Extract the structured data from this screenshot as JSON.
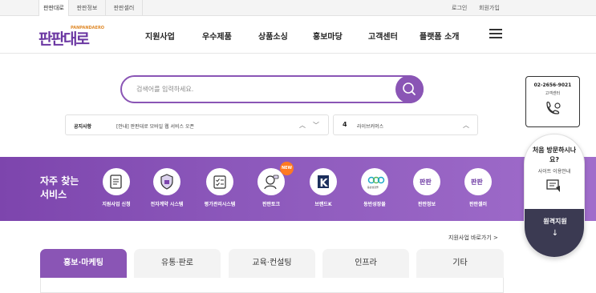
{
  "topbar": {
    "tabs": [
      "판판대로",
      "판판정보",
      "판판셀러"
    ],
    "login": "로그인",
    "signup": "회원가입"
  },
  "header": {
    "logo_text": "판판대로",
    "logo_sub": "PANPANDAERO",
    "nav": [
      "지원사업",
      "우수제품",
      "상품소싱",
      "홍보마당",
      "고객센터",
      "플랫폼 소개"
    ]
  },
  "search": {
    "placeholder": "검색어를 입력하세요."
  },
  "notice": {
    "label": "공지사항",
    "text": "[안내] 판판대로 모바일 웹 서비스 오픈"
  },
  "live": {
    "rank": "4",
    "text": "라이브커머스"
  },
  "services": {
    "title": "자주 찾는 서비스",
    "items": [
      {
        "label": "지원사업 신청",
        "icon": "application-icon"
      },
      {
        "label": "전자계약 시스템",
        "icon": "contract-shield-icon"
      },
      {
        "label": "평가관리시스템",
        "icon": "evaluation-icon"
      },
      {
        "label": "판판토크",
        "icon": "talk-icon",
        "badge": "NEW"
      },
      {
        "label": "브랜드K",
        "icon": "brandk-icon",
        "glyph": "K"
      },
      {
        "label": "동반성장몰",
        "icon": "mall-icon",
        "glyph": "동반성장몰"
      },
      {
        "label": "판판정보",
        "icon": "panpan-info-icon",
        "glyph": "판판"
      },
      {
        "label": "판판셀러",
        "icon": "panpan-seller-icon",
        "glyph": "판판"
      }
    ]
  },
  "shortcut": "지원사업 바로가기 >",
  "tabs": [
    "홍보·마케팅",
    "유통·판로",
    "교육·컨설팅",
    "인프라",
    "기타"
  ],
  "customer_center": {
    "phone": "02-2656-9021",
    "label": "고객센터"
  },
  "first_visit": {
    "question": "처음 방문하시나요?",
    "guide": "사이트 이용안내",
    "remote": "원격지원",
    "arrow": "↓"
  },
  "colors": {
    "accent": "#8a55b5",
    "band": "#8c58bb",
    "remote_bg": "#3b3a52",
    "new_badge": "#ff7a22"
  }
}
